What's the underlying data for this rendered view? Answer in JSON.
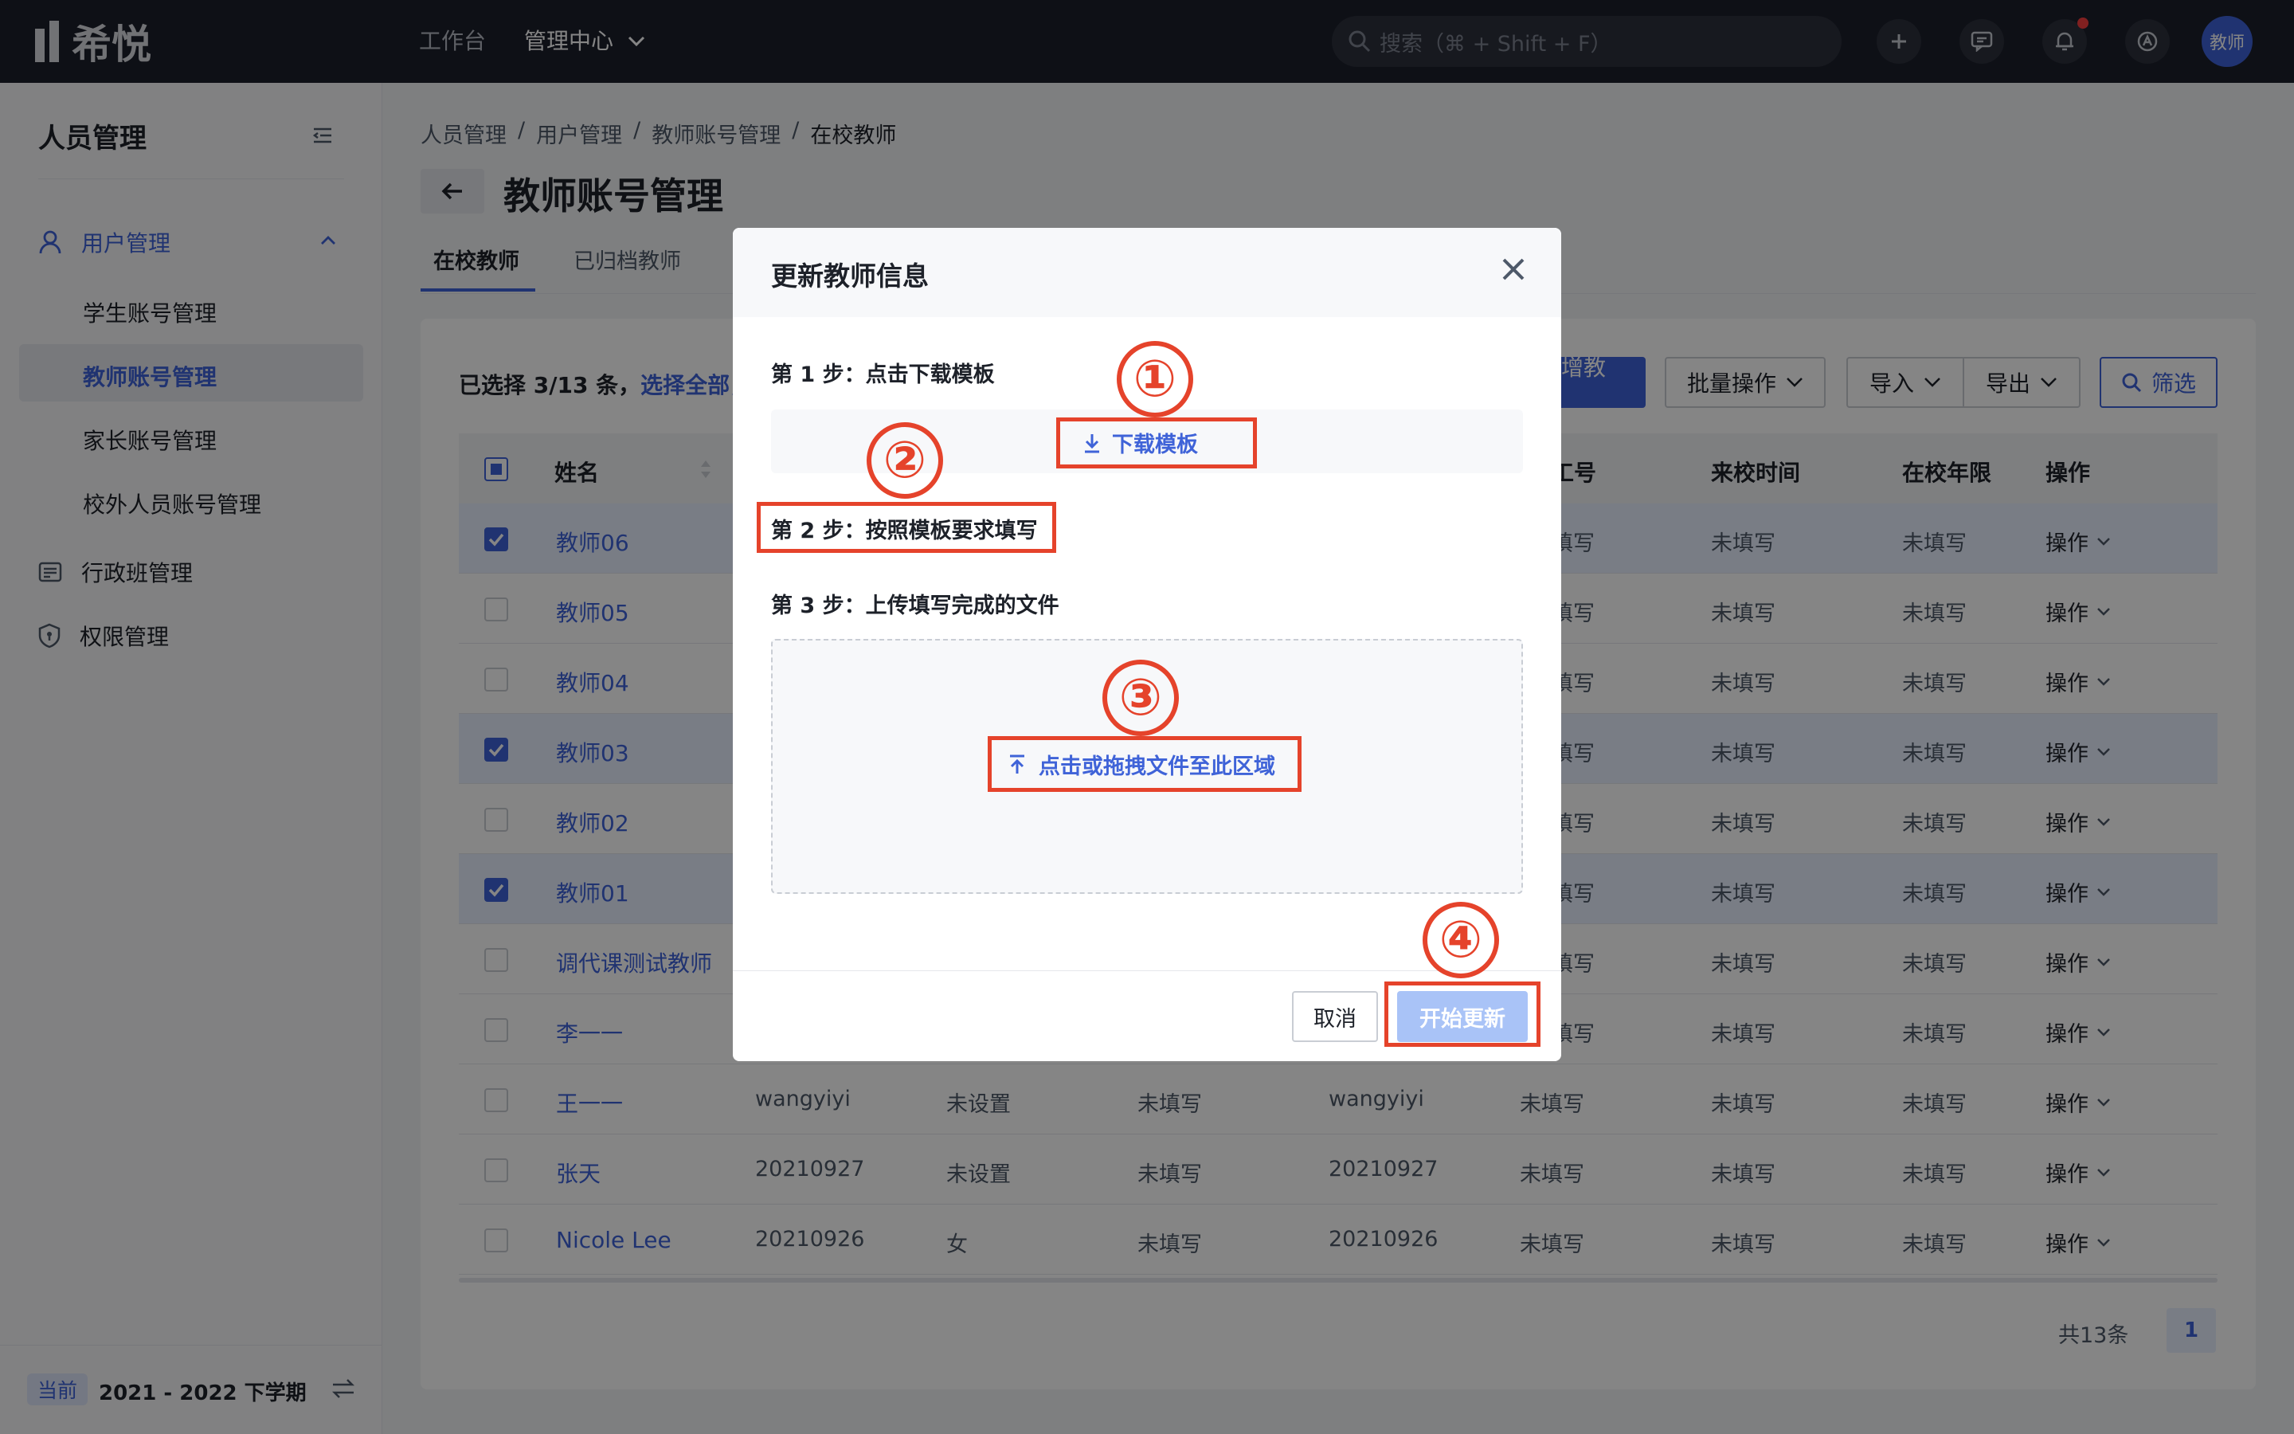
{
  "topbar": {
    "logo_text": "希悦",
    "nav": [
      "工作台",
      "管理中心"
    ],
    "search_placeholder": "搜索（⌘ + Shift + F）",
    "avatar_text": "教师"
  },
  "sidebar": {
    "title": "人员管理",
    "group_user": "用户管理",
    "items": [
      "学生账号管理",
      "教师账号管理",
      "家长账号管理",
      "校外人员账号管理"
    ],
    "group_class": "行政班管理",
    "group_perm": "权限管理",
    "footer_badge": "当前",
    "footer_term": "2021 - 2022 下学期"
  },
  "main": {
    "breadcrumb": [
      "人员管理",
      "/",
      "用户管理",
      "/",
      "教师账号管理",
      "/",
      "在校教师"
    ],
    "title": "教师账号管理",
    "tabs": [
      "在校教师",
      "已归档教师"
    ],
    "selection_text": "已选择 3/13 条，",
    "select_all": "选择全部，",
    "add_button": "新增教师",
    "batch_button": "批量操作",
    "import_button": "导入",
    "export_button": "导出",
    "filter_button": "筛选",
    "columns": {
      "name": "姓名",
      "col6": "工号",
      "col7": "来校时间",
      "col8": "在校年限",
      "col9": "操作"
    },
    "action_label": "操作",
    "unfilled": "未填写",
    "rows": [
      {
        "name": "教师06",
        "checked": true,
        "c2": "",
        "c3": "",
        "c4": "",
        "c5": "",
        "c6": "填写"
      },
      {
        "name": "教师05",
        "checked": false,
        "c2": "",
        "c3": "",
        "c4": "",
        "c5": "",
        "c6": "填写"
      },
      {
        "name": "教师04",
        "checked": false,
        "c2": "",
        "c3": "",
        "c4": "",
        "c5": "",
        "c6": "填写"
      },
      {
        "name": "教师03",
        "checked": true,
        "c2": "",
        "c3": "",
        "c4": "",
        "c5": "",
        "c6": "填写"
      },
      {
        "name": "教师02",
        "checked": false,
        "c2": "",
        "c3": "",
        "c4": "",
        "c5": "",
        "c6": "填写"
      },
      {
        "name": "教师01",
        "checked": true,
        "c2": "",
        "c3": "",
        "c4": "",
        "c5": "",
        "c6": "填写"
      },
      {
        "name": "调代课测试教师",
        "checked": false,
        "c2": "",
        "c3": "",
        "c4": "",
        "c5": "",
        "c6": "填写"
      },
      {
        "name": "李一一",
        "checked": false,
        "c2": "",
        "c3": "",
        "c4": "",
        "c5": "",
        "c6": "填写"
      },
      {
        "name": "王一一",
        "checked": false,
        "c2": "wangyiyi",
        "c3": "未设置",
        "c4": "未填写",
        "c5": "wangyiyi",
        "c6": "未填写"
      },
      {
        "name": "张天",
        "checked": false,
        "c2": "20210927",
        "c3": "未设置",
        "c4": "未填写",
        "c5": "20210927",
        "c6": "未填写"
      },
      {
        "name": "Nicole Lee",
        "checked": false,
        "c2": "20210926",
        "c3": "女",
        "c4": "未填写",
        "c5": "20210926",
        "c6": "未填写"
      }
    ],
    "total": "共13条",
    "page": "1"
  },
  "modal": {
    "title": "更新教师信息",
    "step1": "第 1 步：点击下载模板",
    "download": "下载模板",
    "step2": "第 2 步：按照模板要求填写",
    "step3": "第 3 步：上传填写完成的文件",
    "upload": "点击或拖拽文件至此区域",
    "cancel": "取消",
    "start": "开始更新",
    "markers": [
      "①",
      "②",
      "③",
      "④"
    ]
  },
  "colors": {
    "primary": "#3f63d8",
    "annotation_red": "#e5432b",
    "topbar": "#1c1f2b",
    "start_button_disabled": "#a9c3f7"
  }
}
